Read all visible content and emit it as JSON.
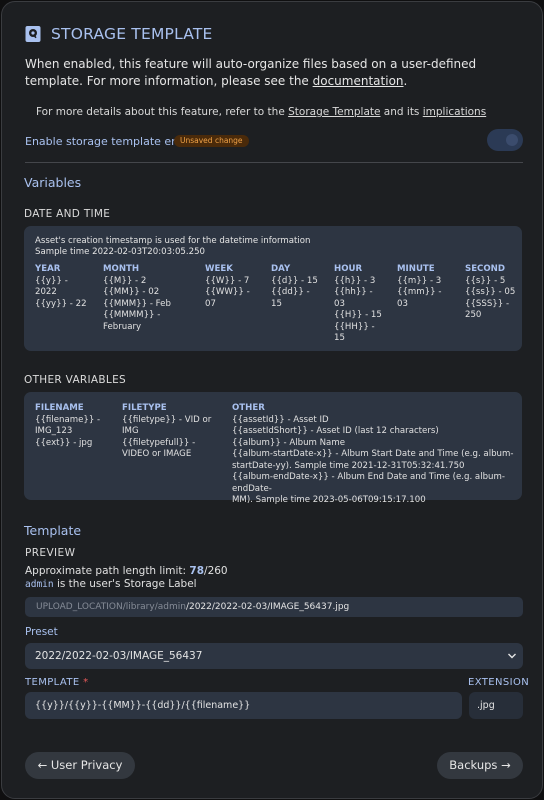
{
  "header": {
    "title": "STORAGE TEMPLATE",
    "description_1": "When enabled, this feature will auto-organize files based on a user-defined template. For more information, please see the ",
    "description_link": "documentation",
    "description_2": ".",
    "icon": "storage-template-icon"
  },
  "note": {
    "prefix": "For more details about this feature, refer to the ",
    "link1": "Storage Template",
    "middle": " and its ",
    "link2": "implications"
  },
  "enable": {
    "label": "Enable storage template engine",
    "badge": "Unsaved change"
  },
  "variables": {
    "title": "Variables",
    "datetime_title": "DATE AND TIME",
    "datetime_info": "Asset's creation timestamp is used for the datetime information",
    "datetime_sample": "Sample time 2022-02-03T20:03:05.250",
    "datetime_columns": [
      {
        "heading": "YEAR",
        "lines": [
          "{{y}} -",
          "2022",
          "{{yy}} - 22"
        ]
      },
      {
        "heading": "MONTH",
        "lines": [
          "{{M}} - 2",
          "{{MM}} - 02",
          "{{MMM}} - Feb",
          "{{MMMM}} -",
          "February"
        ]
      },
      {
        "heading": "WEEK",
        "lines": [
          "{{W}} - 7",
          "{{WW}} -",
          "07"
        ]
      },
      {
        "heading": "DAY",
        "lines": [
          "{{d}} - 15",
          "{{dd}} -",
          "15"
        ]
      },
      {
        "heading": "HOUR",
        "lines": [
          "{{h}} - 3",
          "{{hh}} -",
          "03",
          "{{H}} - 15",
          "{{HH}} -",
          "15"
        ]
      },
      {
        "heading": "MINUTE",
        "lines": [
          "{{m}} - 3",
          "{{mm}} -",
          "03"
        ]
      },
      {
        "heading": "SECOND",
        "lines": [
          "{{s}} - 5",
          "{{ss}} - 05",
          "{{SSS}} -",
          "250"
        ]
      }
    ],
    "other_title": "OTHER VARIABLES",
    "other_columns": [
      {
        "heading": "FILENAME",
        "lines": [
          "{{filename}} -",
          "IMG_123",
          "{{ext}} - jpg"
        ]
      },
      {
        "heading": "FILETYPE",
        "lines": [
          "{{filetype}} - VID or",
          "IMG",
          "{{filetypefull}} -",
          "VIDEO or IMAGE"
        ]
      },
      {
        "heading": "OTHER",
        "lines": [
          "{{assetId}} - Asset ID",
          "{{assetIdShort}} - Asset ID (last 12 characters)",
          "{{album}} - Album Name",
          "{{album-startDate-x}} - Album Start Date and Time (e.g. album-",
          "startDate-yy). Sample time 2021-12-31T05:32:41.750",
          "{{album-endDate-x}} - Album End Date and Time (e.g. album-endDate-",
          "MM). Sample time 2023-05-06T09:15:17.100"
        ]
      }
    ]
  },
  "template": {
    "title": "Template",
    "preview_label": "PREVIEW",
    "limit_prefix": "Approximate path length limit: ",
    "limit_value": "78",
    "limit_suffix": "/260",
    "storage_label": "admin",
    "storage_label_suffix": " is the user's Storage Label",
    "path_prefix": "UPLOAD_LOCATION/library/admin",
    "path_value": "/2022/2022-02-03/IMAGE_56437.jpg",
    "preset_label": "Preset",
    "preset_value": "2022/2022-02-03/IMAGE_56437",
    "template_label": "TEMPLATE",
    "required_mark": "*",
    "extension_label": "EXTENSION",
    "template_value": "{{y}}/{{y}}-{{MM}}-{{dd}}/{{filename}}",
    "extension_value": ".jpg"
  },
  "nav": {
    "back_label": "User Privacy",
    "next_label": "Backups"
  },
  "colors": {
    "accent": "#a9c1ef",
    "background": "#1d1f22",
    "panel": "#2d3542",
    "badge_bg": "#4a2a0a",
    "badge_fg": "#f0a247",
    "required": "#e85a5a"
  }
}
